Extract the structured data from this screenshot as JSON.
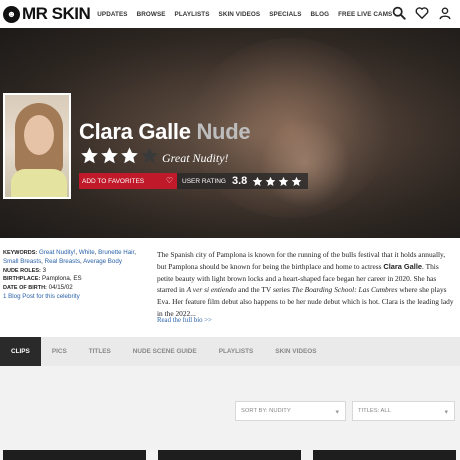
{
  "nav": {
    "logo_text": "MR SKIN",
    "links": [
      "UPDATES",
      "BROWSE",
      "PLAYLISTS",
      "SKIN VIDEOS",
      "SPECIALS",
      "BLOG",
      "FREE LIVE CAMS"
    ]
  },
  "hero": {
    "first_name": "Clara Galle",
    "nude_word": "Nude",
    "rating_stars": 3,
    "rating_stars_max": 4,
    "rating_text": "Great Nudity!",
    "favorites_label": "ADD TO FAVORITES",
    "user_rating_label": "USER RATING",
    "user_rating_value": "3.8",
    "user_rating_stars": 4
  },
  "info": {
    "keywords_key": "KEYWORDS:",
    "keywords": [
      "Great Nudity!",
      "White",
      "Brunette Hair",
      "Small Breasts",
      "Real Breasts",
      "Average Body"
    ],
    "nude_roles_key": "NUDE ROLES:",
    "nude_roles": "3",
    "birthplace_key": "BIRTHPLACE:",
    "birthplace": "Pamplona, ES",
    "dob_key": "DATE OF BIRTH:",
    "dob": "04/15/02",
    "blog_link": "1 Blog Post for this celebrity"
  },
  "bio": {
    "p1": "The Spanish city of Pamplona is known for the running of the bulls festival that it holds annually, but Pamplona should be known for being the birthplace and home to actress ",
    "name_bold": "Clara Galle",
    "p2": ". This petite beauty with light brown locks and a heart-shaped face began her career in 2020. She has starred in ",
    "title1": "A ver si entiendo",
    "p3": " and the TV series ",
    "title2": "The Boarding School: Las Cumbres",
    "p4": " where she plays Eva. Her feature film debut also happens to be her nude debut which is hot. Clara is the leading lady in the 2022...",
    "read_more": "Read the full bio >>"
  },
  "tabs": [
    "CLIPS",
    "PICS",
    "TITLES",
    "NUDE SCENE GUIDE",
    "PLAYLISTS",
    "SKIN VIDEOS"
  ],
  "filters": {
    "sort": "SORT BY: NUDITY",
    "titles": "TITLES: ALL"
  },
  "colors": {
    "accent_red": "#c0192a",
    "link_blue": "#2a62a8",
    "tab_active": "#2a2a2a"
  }
}
